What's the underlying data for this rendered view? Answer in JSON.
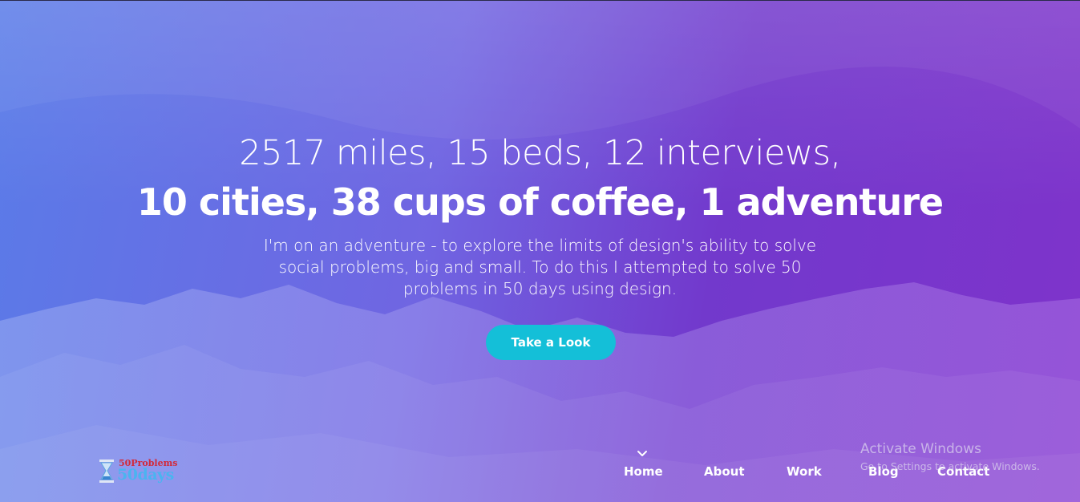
{
  "hero": {
    "headline_line1": "2517 miles, 15 beds, 12 interviews,",
    "headline_line2": "10 cities, 38 cups of coffee, 1 adventure",
    "lead": "I'm on an adventure - to explore the limits of design's ability to solve social problems, big and small. To do this I attempted to solve 50 problems in 50 days using design.",
    "cta_label": "Take a Look",
    "accent_color": "#14bfd8",
    "gradient_colors": [
      "#4c70e6",
      "#5c50de",
      "#6628c8",
      "#7828c8"
    ]
  },
  "logo": {
    "top_text": "50Problems",
    "bottom_text": "50days",
    "icon": "hourglass-logo-icon"
  },
  "nav": {
    "items": [
      {
        "label": "Home",
        "active": true
      },
      {
        "label": "About"
      },
      {
        "label": "Work"
      },
      {
        "label": "Blog"
      },
      {
        "label": "Contact"
      }
    ],
    "active_indicator_icon": "chevron-down-icon"
  },
  "watermark": {
    "title": "Activate Windows",
    "subtitle": "Go to Settings to activate Windows."
  }
}
